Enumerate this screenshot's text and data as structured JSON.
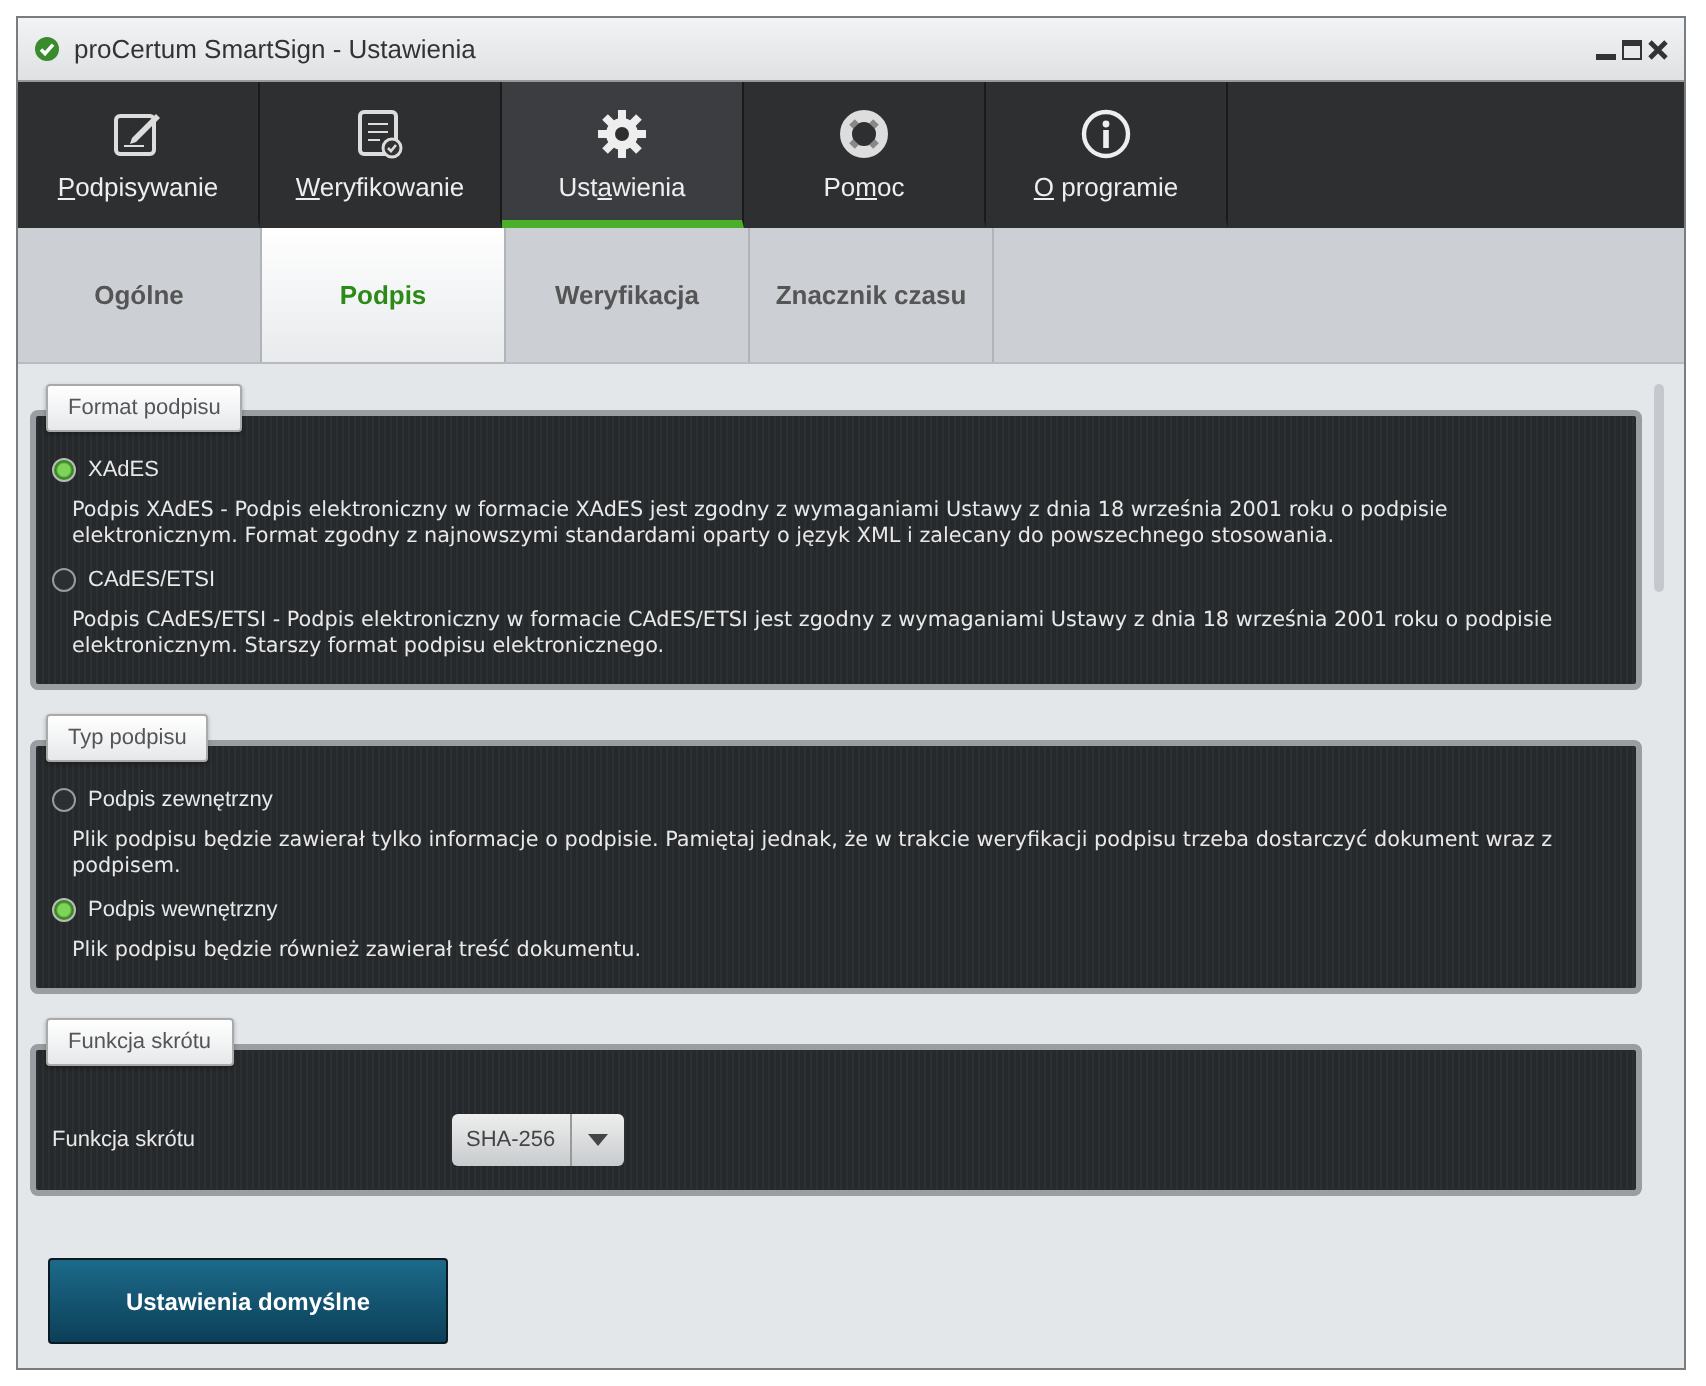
{
  "window": {
    "title": "proCertum SmartSign - Ustawienia"
  },
  "nav": [
    {
      "mnemonic": "P",
      "label_end": "odpisywanie",
      "selected": false
    },
    {
      "mnemonic": "W",
      "label_end": "eryfikowanie",
      "selected": false
    },
    {
      "label_start": "Ust",
      "mnemonic": "a",
      "label_end": "wienia",
      "selected": true
    },
    {
      "label_start": "Po",
      "mnemonic": "m",
      "label_end": "oc",
      "selected": false
    },
    {
      "mnemonic": "O",
      "label_end": " programie",
      "selected": false
    }
  ],
  "subtabs": [
    {
      "label": "Ogólne",
      "selected": false
    },
    {
      "label": "Podpis",
      "selected": true
    },
    {
      "label": "Weryfikacja",
      "selected": false
    },
    {
      "label": "Znacznik czasu",
      "selected": false
    }
  ],
  "groups": [
    {
      "title": "Format podpisu",
      "kind": "radio",
      "options": [
        {
          "label": "XAdES",
          "selected": true,
          "description": "Podpis XAdES - Podpis elektroniczny w formacie XAdES jest zgodny z wymaganiami Ustawy z dnia 18 września 2001 roku o podpisie elektronicznym. Format zgodny z najnowszymi standardami oparty o język XML i zalecany do powszechnego stosowania."
        },
        {
          "label": "CAdES/ETSI",
          "selected": false,
          "description": "Podpis CAdES/ETSI - Podpis elektroniczny w formacie CAdES/ETSI jest zgodny z wymaganiami Ustawy z dnia 18 września 2001 roku o podpisie elektronicznym. Starszy format podpisu elektronicznego."
        }
      ]
    },
    {
      "title": "Typ podpisu",
      "kind": "radio",
      "options": [
        {
          "label": "Podpis zewnętrzny",
          "selected": false,
          "description": "Plik podpisu będzie zawierał tylko informacje o podpisie. Pamiętaj jednak, że w trakcie weryfikacji podpisu trzeba dostarczyć dokument wraz z podpisem."
        },
        {
          "label": "Podpis wewnętrzny",
          "selected": true,
          "description": "Plik podpisu będzie również zawierał treść dokumentu."
        }
      ]
    },
    {
      "title": "Funkcja skrótu",
      "kind": "select",
      "label": "Funkcja skrótu",
      "value": "SHA-256"
    }
  ],
  "default_button": "Ustawienia domyślne"
}
